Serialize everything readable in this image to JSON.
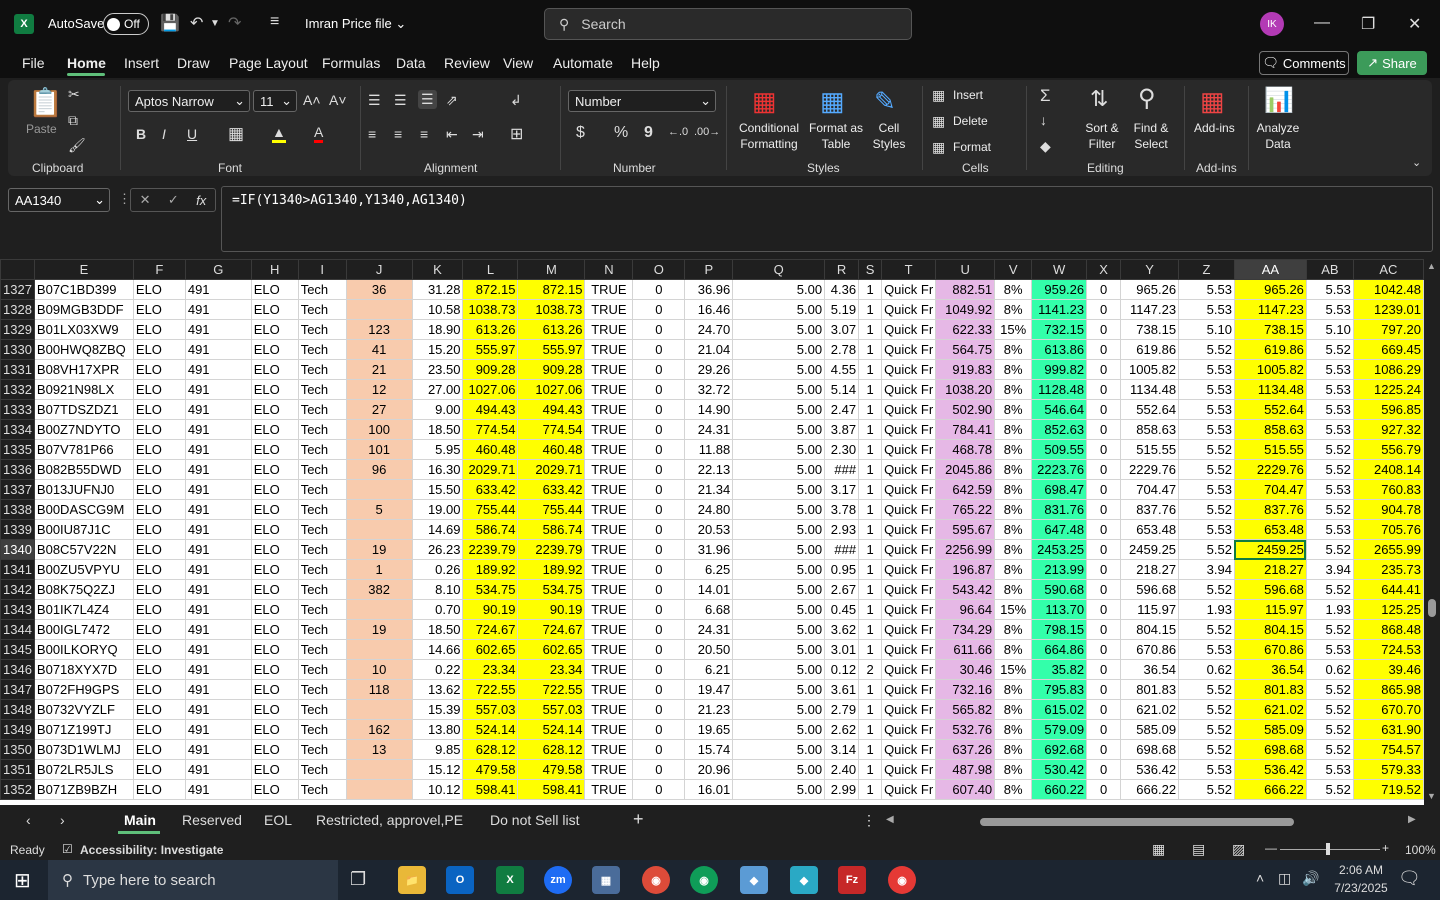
{
  "titlebar": {
    "app_icon": "X",
    "autosave_label": "AutoSave",
    "autosave_state": "Off",
    "filename": "Imran Price file",
    "search_placeholder": "Search",
    "avatar_initials": "IK"
  },
  "menu": {
    "items": [
      "File",
      "Home",
      "Insert",
      "Draw",
      "Page Layout",
      "Formulas",
      "Data",
      "Review",
      "View",
      "Automate",
      "Help"
    ],
    "active": "Home",
    "comments_label": "Comments",
    "share_label": "Share"
  },
  "ribbon": {
    "clipboard": {
      "paste": "Paste",
      "label": "Clipboard"
    },
    "font": {
      "name": "Aptos Narrow",
      "size": "11",
      "label": "Font"
    },
    "alignment": {
      "label": "Alignment"
    },
    "number": {
      "format": "Number",
      "label": "Number",
      "currency": "$",
      "percent": "%",
      "comma": "9"
    },
    "styles": {
      "conditional": "Conditional Formatting",
      "format_table": "Format as Table",
      "cell_styles": "Cell Styles",
      "label": "Styles"
    },
    "cells": {
      "insert": "Insert",
      "delete": "Delete",
      "format": "Format",
      "label": "Cells"
    },
    "editing": {
      "sort": "Sort & Filter",
      "find": "Find & Select",
      "label": "Editing"
    },
    "addins": {
      "addins": "Add-ins",
      "label": "Add-ins"
    },
    "analyze": {
      "label": "Analyze Data"
    }
  },
  "formula_bar": {
    "name_box": "AA1340",
    "formula": "=IF(Y1340>AG1340,Y1340,AG1340)"
  },
  "columns": [
    "E",
    "F",
    "G",
    "H",
    "I",
    "J",
    "K",
    "L",
    "M",
    "N",
    "O",
    "P",
    "Q",
    "R",
    "S",
    "T",
    "U",
    "V",
    "W",
    "X",
    "Y",
    "Z",
    "AA",
    "AB",
    "AC"
  ],
  "rows": [
    [
      "1327",
      "B07C1BD399",
      "ELO",
      "491",
      "ELO",
      "Tech",
      "36",
      "31.28",
      "872.15",
      "872.15",
      "TRUE",
      "0",
      "36.96",
      "5.00",
      "4.36",
      "1",
      "Quick Fr",
      "882.51",
      "8%",
      "959.26",
      "0",
      "965.26",
      "5.53",
      "965.26",
      "5.53",
      "1042.48"
    ],
    [
      "1328",
      "B09MGB3DDF",
      "ELO",
      "491",
      "ELO",
      "Tech",
      "",
      "10.58",
      "1038.73",
      "1038.73",
      "TRUE",
      "0",
      "16.46",
      "5.00",
      "5.19",
      "1",
      "Quick Fr",
      "1049.92",
      "8%",
      "1141.23",
      "0",
      "1147.23",
      "5.53",
      "1147.23",
      "5.53",
      "1239.01"
    ],
    [
      "1329",
      "B01LX03XW9",
      "ELO",
      "491",
      "ELO",
      "Tech",
      "123",
      "18.90",
      "613.26",
      "613.26",
      "TRUE",
      "0",
      "24.70",
      "5.00",
      "3.07",
      "1",
      "Quick Fr",
      "622.33",
      "15%",
      "732.15",
      "0",
      "738.15",
      "5.10",
      "738.15",
      "5.10",
      "797.20"
    ],
    [
      "1330",
      "B00HWQ8ZBQ",
      "ELO",
      "491",
      "ELO",
      "Tech",
      "41",
      "15.20",
      "555.97",
      "555.97",
      "TRUE",
      "0",
      "21.04",
      "5.00",
      "2.78",
      "1",
      "Quick Fr",
      "564.75",
      "8%",
      "613.86",
      "0",
      "619.86",
      "5.52",
      "619.86",
      "5.52",
      "669.45"
    ],
    [
      "1331",
      "B08VH17XPR",
      "ELO",
      "491",
      "ELO",
      "Tech",
      "21",
      "23.50",
      "909.28",
      "909.28",
      "TRUE",
      "0",
      "29.26",
      "5.00",
      "4.55",
      "1",
      "Quick Fr",
      "919.83",
      "8%",
      "999.82",
      "0",
      "1005.82",
      "5.53",
      "1005.82",
      "5.53",
      "1086.29"
    ],
    [
      "1332",
      "B0921N98LX",
      "ELO",
      "491",
      "ELO",
      "Tech",
      "12",
      "27.00",
      "1027.06",
      "1027.06",
      "TRUE",
      "0",
      "32.72",
      "5.00",
      "5.14",
      "1",
      "Quick Fr",
      "1038.20",
      "8%",
      "1128.48",
      "0",
      "1134.48",
      "5.53",
      "1134.48",
      "5.53",
      "1225.24"
    ],
    [
      "1333",
      "B07TDSZDZ1",
      "ELO",
      "491",
      "ELO",
      "Tech",
      "27",
      "9.00",
      "494.43",
      "494.43",
      "TRUE",
      "0",
      "14.90",
      "5.00",
      "2.47",
      "1",
      "Quick Fr",
      "502.90",
      "8%",
      "546.64",
      "0",
      "552.64",
      "5.53",
      "552.64",
      "5.53",
      "596.85"
    ],
    [
      "1334",
      "B00Z7NDYTO",
      "ELO",
      "491",
      "ELO",
      "Tech",
      "100",
      "18.50",
      "774.54",
      "774.54",
      "TRUE",
      "0",
      "24.31",
      "5.00",
      "3.87",
      "1",
      "Quick Fr",
      "784.41",
      "8%",
      "852.63",
      "0",
      "858.63",
      "5.53",
      "858.63",
      "5.53",
      "927.32"
    ],
    [
      "1335",
      "B07V781P66",
      "ELO",
      "491",
      "ELO",
      "Tech",
      "101",
      "5.95",
      "460.48",
      "460.48",
      "TRUE",
      "0",
      "11.88",
      "5.00",
      "2.30",
      "1",
      "Quick Fr",
      "468.78",
      "8%",
      "509.55",
      "0",
      "515.55",
      "5.52",
      "515.55",
      "5.52",
      "556.79"
    ],
    [
      "1336",
      "B082B55DWD",
      "ELO",
      "491",
      "ELO",
      "Tech",
      "96",
      "16.30",
      "2029.71",
      "2029.71",
      "TRUE",
      "0",
      "22.13",
      "5.00",
      "###",
      "1",
      "Quick Fr",
      "2045.86",
      "8%",
      "2223.76",
      "0",
      "2229.76",
      "5.52",
      "2229.76",
      "5.52",
      "2408.14"
    ],
    [
      "1337",
      "B013JUFNJ0",
      "ELO",
      "491",
      "ELO",
      "Tech",
      "",
      "15.50",
      "633.42",
      "633.42",
      "TRUE",
      "0",
      "21.34",
      "5.00",
      "3.17",
      "1",
      "Quick Fr",
      "642.59",
      "8%",
      "698.47",
      "0",
      "704.47",
      "5.53",
      "704.47",
      "5.53",
      "760.83"
    ],
    [
      "1338",
      "B00DASCG9M",
      "ELO",
      "491",
      "ELO",
      "Tech",
      "5",
      "19.00",
      "755.44",
      "755.44",
      "TRUE",
      "0",
      "24.80",
      "5.00",
      "3.78",
      "1",
      "Quick Fr",
      "765.22",
      "8%",
      "831.76",
      "0",
      "837.76",
      "5.52",
      "837.76",
      "5.52",
      "904.78"
    ],
    [
      "1339",
      "B00IU87J1C",
      "ELO",
      "491",
      "ELO",
      "Tech",
      "",
      "14.69",
      "586.74",
      "586.74",
      "TRUE",
      "0",
      "20.53",
      "5.00",
      "2.93",
      "1",
      "Quick Fr",
      "595.67",
      "8%",
      "647.48",
      "0",
      "653.48",
      "5.53",
      "653.48",
      "5.53",
      "705.76"
    ],
    [
      "1340",
      "B08C57V22N",
      "ELO",
      "491",
      "ELO",
      "Tech",
      "19",
      "26.23",
      "2239.79",
      "2239.79",
      "TRUE",
      "0",
      "31.96",
      "5.00",
      "###",
      "1",
      "Quick Fr",
      "2256.99",
      "8%",
      "2453.25",
      "0",
      "2459.25",
      "5.52",
      "2459.25",
      "5.52",
      "2655.99"
    ],
    [
      "1341",
      "B00ZU5VPYU",
      "ELO",
      "491",
      "ELO",
      "Tech",
      "1",
      "0.26",
      "189.92",
      "189.92",
      "TRUE",
      "0",
      "6.25",
      "5.00",
      "0.95",
      "1",
      "Quick Fr",
      "196.87",
      "8%",
      "213.99",
      "0",
      "218.27",
      "3.94",
      "218.27",
      "3.94",
      "235.73"
    ],
    [
      "1342",
      "B08K75Q2ZJ",
      "ELO",
      "491",
      "ELO",
      "Tech",
      "382",
      "8.10",
      "534.75",
      "534.75",
      "TRUE",
      "0",
      "14.01",
      "5.00",
      "2.67",
      "1",
      "Quick Fr",
      "543.42",
      "8%",
      "590.68",
      "0",
      "596.68",
      "5.52",
      "596.68",
      "5.52",
      "644.41"
    ],
    [
      "1343",
      "B01IK7L4Z4",
      "ELO",
      "491",
      "ELO",
      "Tech",
      "",
      "0.70",
      "90.19",
      "90.19",
      "TRUE",
      "0",
      "6.68",
      "5.00",
      "0.45",
      "1",
      "Quick Fr",
      "96.64",
      "15%",
      "113.70",
      "0",
      "115.97",
      "1.93",
      "115.97",
      "1.93",
      "125.25"
    ],
    [
      "1344",
      "B00IGL7472",
      "ELO",
      "491",
      "ELO",
      "Tech",
      "19",
      "18.50",
      "724.67",
      "724.67",
      "TRUE",
      "0",
      "24.31",
      "5.00",
      "3.62",
      "1",
      "Quick Fr",
      "734.29",
      "8%",
      "798.15",
      "0",
      "804.15",
      "5.52",
      "804.15",
      "5.52",
      "868.48"
    ],
    [
      "1345",
      "B00ILKORYQ",
      "ELO",
      "491",
      "ELO",
      "Tech",
      "",
      "14.66",
      "602.65",
      "602.65",
      "TRUE",
      "0",
      "20.50",
      "5.00",
      "3.01",
      "1",
      "Quick Fr",
      "611.66",
      "8%",
      "664.86",
      "0",
      "670.86",
      "5.53",
      "670.86",
      "5.53",
      "724.53"
    ],
    [
      "1346",
      "B0718XYX7D",
      "ELO",
      "491",
      "ELO",
      "Tech",
      "10",
      "0.22",
      "23.34",
      "23.34",
      "TRUE",
      "0",
      "6.21",
      "5.00",
      "0.12",
      "2",
      "Quick Fr",
      "30.46",
      "15%",
      "35.82",
      "0",
      "36.54",
      "0.62",
      "36.54",
      "0.62",
      "39.46"
    ],
    [
      "1347",
      "B072FH9GPS",
      "ELO",
      "491",
      "ELO",
      "Tech",
      "118",
      "13.62",
      "722.55",
      "722.55",
      "TRUE",
      "0",
      "19.47",
      "5.00",
      "3.61",
      "1",
      "Quick Fr",
      "732.16",
      "8%",
      "795.83",
      "0",
      "801.83",
      "5.52",
      "801.83",
      "5.52",
      "865.98"
    ],
    [
      "1348",
      "B0732VYZLF",
      "ELO",
      "491",
      "ELO",
      "Tech",
      "",
      "15.39",
      "557.03",
      "557.03",
      "TRUE",
      "0",
      "21.23",
      "5.00",
      "2.79",
      "1",
      "Quick Fr",
      "565.82",
      "8%",
      "615.02",
      "0",
      "621.02",
      "5.52",
      "621.02",
      "5.52",
      "670.70"
    ],
    [
      "1349",
      "B071Z199TJ",
      "ELO",
      "491",
      "ELO",
      "Tech",
      "162",
      "13.80",
      "524.14",
      "524.14",
      "TRUE",
      "0",
      "19.65",
      "5.00",
      "2.62",
      "1",
      "Quick Fr",
      "532.76",
      "8%",
      "579.09",
      "0",
      "585.09",
      "5.52",
      "585.09",
      "5.52",
      "631.90"
    ],
    [
      "1350",
      "B073D1WLMJ",
      "ELO",
      "491",
      "ELO",
      "Tech",
      "13",
      "9.85",
      "628.12",
      "628.12",
      "TRUE",
      "0",
      "15.74",
      "5.00",
      "3.14",
      "1",
      "Quick Fr",
      "637.26",
      "8%",
      "692.68",
      "0",
      "698.68",
      "5.52",
      "698.68",
      "5.52",
      "754.57"
    ],
    [
      "1351",
      "B072LR5JLS",
      "ELO",
      "491",
      "ELO",
      "Tech",
      "",
      "15.12",
      "479.58",
      "479.58",
      "TRUE",
      "0",
      "20.96",
      "5.00",
      "2.40",
      "1",
      "Quick Fr",
      "487.98",
      "8%",
      "530.42",
      "0",
      "536.42",
      "5.53",
      "536.42",
      "5.53",
      "579.33"
    ],
    [
      "1352",
      "B071ZB9BZH",
      "ELO",
      "491",
      "ELO",
      "Tech",
      "",
      "10.12",
      "598.41",
      "598.41",
      "TRUE",
      "0",
      "16.01",
      "5.00",
      "2.99",
      "1",
      "Quick Fr",
      "607.40",
      "8%",
      "660.22",
      "0",
      "666.22",
      "5.52",
      "666.22",
      "5.52",
      "719.52"
    ]
  ],
  "selected_row": "1340",
  "selected_col": "AA",
  "sheet_tabs": [
    "Main",
    "Reserved",
    "EOL",
    "Restricted, approvel,PE",
    "Do not Sell list"
  ],
  "active_sheet": "Main",
  "status": {
    "ready": "Ready",
    "accessibility": "Accessibility: Investigate",
    "zoom": "100%"
  },
  "taskbar": {
    "search_placeholder": "Type here to search",
    "time": "2:06 AM",
    "date": "7/23/2025"
  },
  "colors": {
    "yellow": "#ffff00",
    "pink": "#f8cbad",
    "violet": "#e6b8e6",
    "green": "#33ffaa",
    "accent": "#107c41"
  }
}
